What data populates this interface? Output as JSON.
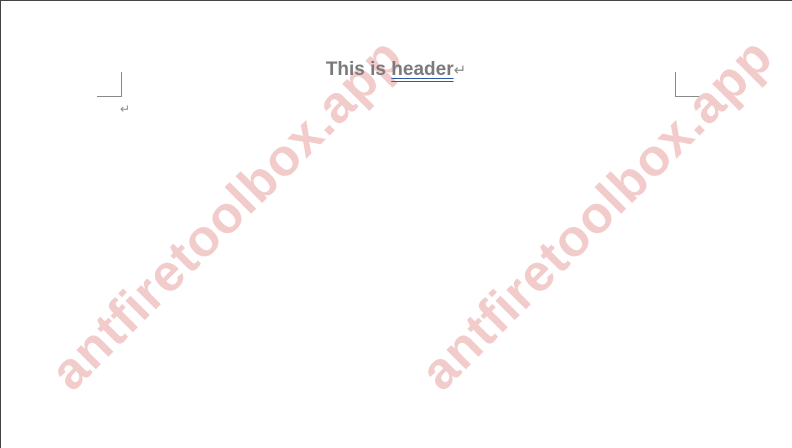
{
  "document": {
    "header_text_plain": "This is ",
    "header_text_underlined": "header",
    "paragraph_mark": "↵",
    "empty_paragraph_mark": "↵"
  },
  "watermark": {
    "text": "antfiretoolbox.app",
    "color": "#f2c9c9"
  },
  "colors": {
    "spelling_underline": "#2f5aa8"
  }
}
